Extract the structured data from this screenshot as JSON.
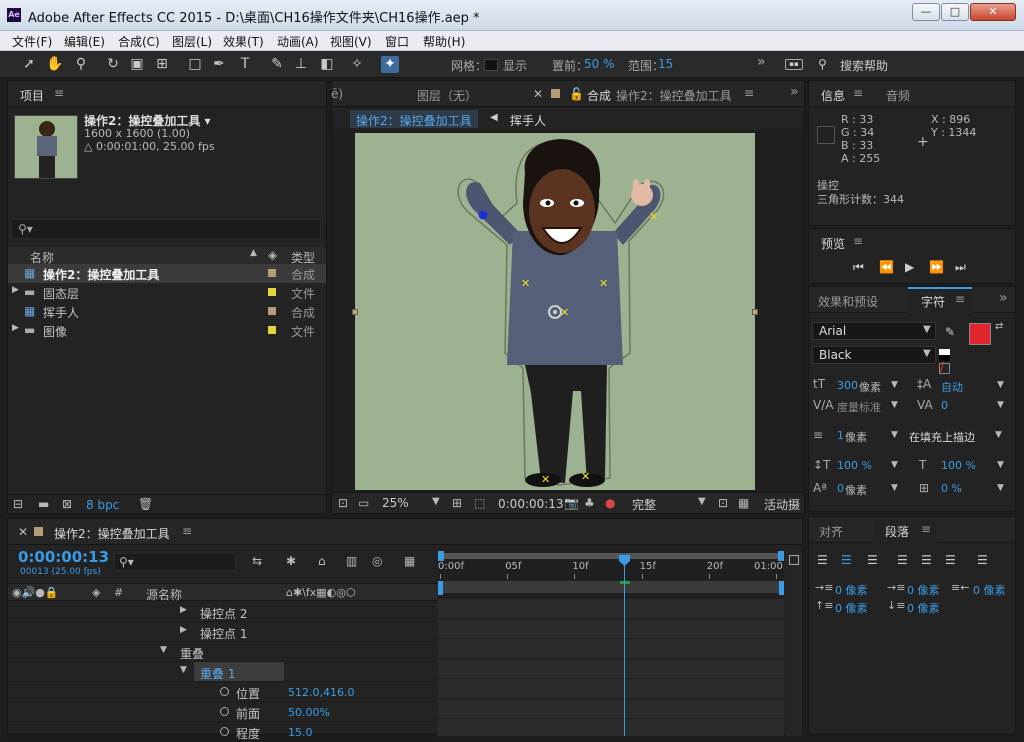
{
  "window": {
    "app_letters": "Ae",
    "title": "Adobe After Effects CC 2015 - D:\\桌面\\CH16操作文件夹\\CH16操作.aep *",
    "min": "—",
    "max": "□",
    "close": "✕"
  },
  "menu": [
    "文件(F)",
    "编辑(E)",
    "合成(C)",
    "图层(L)",
    "效果(T)",
    "动画(A)",
    "视图(V)",
    "窗口",
    "帮助(H)"
  ],
  "toolbar": {
    "mesh_label": "网格：",
    "show_label": "显示",
    "expansion_label": "置前：",
    "expansion_value": "50 %",
    "range_label": "范围：",
    "range_value": "15",
    "more": "»",
    "search_help": "搜索帮助"
  },
  "project": {
    "tab": "项目",
    "comp_name": "操作2：操控叠加工具 ▾",
    "comp_size": "1600 x 1600 (1.00)",
    "comp_duration": "△ 0:00:01:00, 25.00 fps",
    "search_icon": "⚲▾",
    "col_name": "名称",
    "col_type": "类型",
    "items": [
      {
        "name": "操作2：操控叠加工具",
        "type": "合成",
        "arrow": "",
        "color": "#b59d7a",
        "icon": "comp-icon"
      },
      {
        "name": "固态层",
        "type": "文件",
        "arrow": "▶",
        "color": "#e5d53a",
        "icon": "folder-icon"
      },
      {
        "name": "挥手人",
        "type": "合成",
        "arrow": "",
        "color": "#b59d7a",
        "icon": "comp-icon"
      },
      {
        "name": "图像",
        "type": "文件",
        "arrow": "▶",
        "color": "#e5d53a",
        "icon": "folder-icon"
      }
    ],
    "bpc": "8 bpc"
  },
  "comp": {
    "tab_prev": "ē)",
    "tab_layer": "图层（无）",
    "tab_comp_prefix": "合成",
    "tab_comp_name": "操作2：操控叠加工具",
    "crumb1": "操作2：操控叠加工具",
    "crumb2": "挥手人",
    "zoom": "25%",
    "timecode": "0:00:00:13",
    "quality": "完整",
    "active_cam": "活动摄"
  },
  "info": {
    "tab": "信息",
    "tab2": "音频",
    "r": "R : 33",
    "g": "G : 34",
    "b": "B : 33",
    "a": "A : 255",
    "x": "X : 896",
    "y": "Y : 1344",
    "tool": "操控",
    "triangles": "三角形计数：344"
  },
  "preview": {
    "tab": "预览"
  },
  "character": {
    "tab_effects": "效果和预设",
    "tab": "字符",
    "font": "Arial",
    "style": "Black",
    "size": "300",
    "size_unit": "像素",
    "leading": "自动",
    "kerning": "度量标准",
    "tracking": "0",
    "stroke": "1",
    "stroke_unit": "像素",
    "stroke_mode": "在填充上描边",
    "vscale": "100 %",
    "hscale": "100 %",
    "baseline": "0",
    "baseline_unit": "像素",
    "tsume": "0 %",
    "fill_color": "#e0262c",
    "stroke_color": "#000000"
  },
  "paragraph": {
    "tab_align": "对齐",
    "tab": "段落",
    "indent1": "0 像素",
    "indent2": "0 像素",
    "indent3": "0 像素",
    "space1": "0 像素",
    "space2": "0 像素"
  },
  "timeline": {
    "tab": "操作2：操控叠加工具",
    "timecode": "0:00:00:13",
    "frame": "00013 (25.00 fps)",
    "col_num": "#",
    "col_src": "源名称",
    "ruler": [
      "0:00f",
      "05f",
      "10f",
      "15f",
      "20f",
      "01:00"
    ],
    "rows": [
      {
        "arrow": "▶",
        "label": "操控点 2",
        "value": "",
        "indent": 1,
        "stopwatch": false
      },
      {
        "arrow": "▶",
        "label": "操控点 1",
        "value": "",
        "indent": 1,
        "stopwatch": false
      },
      {
        "arrow": "▼",
        "label": "重叠",
        "value": "",
        "indent": 0,
        "stopwatch": false
      },
      {
        "arrow": "▼",
        "label": "重叠 1",
        "value": "",
        "indent": 1,
        "stopwatch": false,
        "selected": true
      },
      {
        "arrow": "",
        "label": "位置",
        "value": "512.0,416.0",
        "indent": 2,
        "stopwatch": true
      },
      {
        "arrow": "",
        "label": "前面",
        "value": "50.00%",
        "indent": 2,
        "stopwatch": true
      },
      {
        "arrow": "",
        "label": "程度",
        "value": "15.0",
        "indent": 2,
        "stopwatch": true
      }
    ]
  }
}
